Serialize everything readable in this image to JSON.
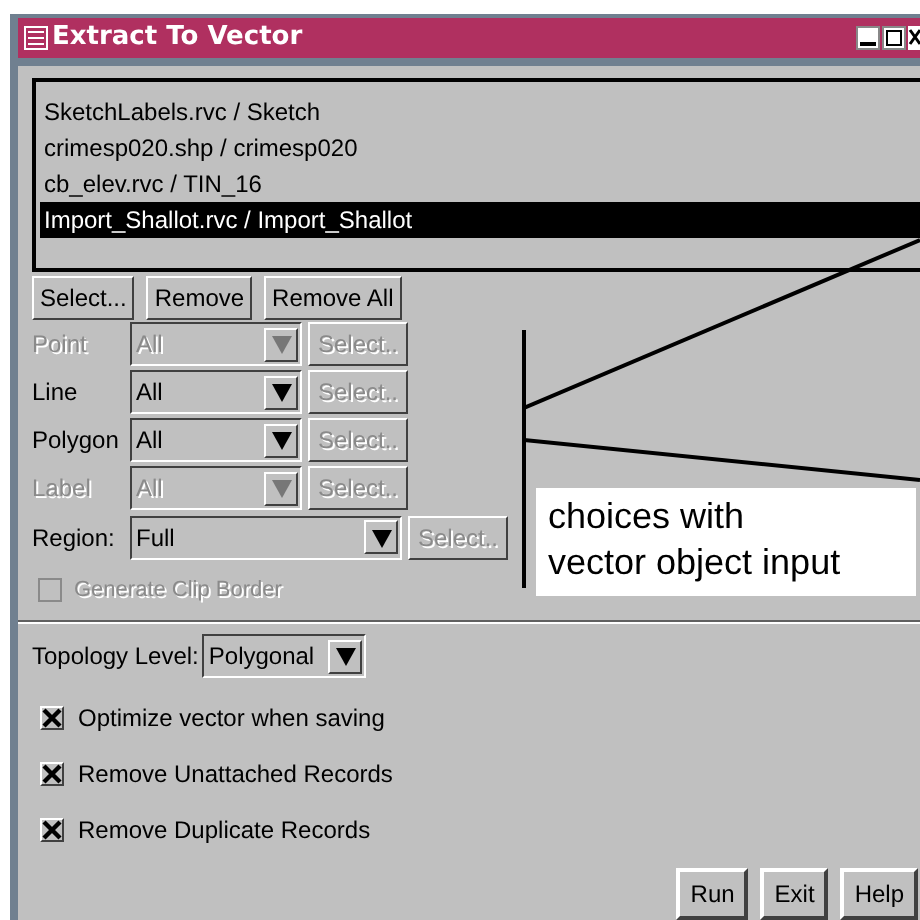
{
  "window": {
    "title": "Extract To Vector"
  },
  "files": [
    {
      "text": "SketchLabels.rvc / Sketch",
      "selected": false
    },
    {
      "text": "crimesp020.shp / crimesp020",
      "selected": false
    },
    {
      "text": "cb_elev.rvc / TIN_16",
      "selected": false
    },
    {
      "text": "Import_Shallot.rvc / Import_Shallot",
      "selected": true
    }
  ],
  "list_buttons": [
    "Select...",
    "Remove",
    "Remove All"
  ],
  "object_rows": [
    {
      "label": "Point",
      "disabled": true,
      "value": "All",
      "button": {
        "label": "Select..",
        "disabled": true
      }
    },
    {
      "label": "Line",
      "disabled": false,
      "value": "All",
      "button": {
        "label": "Select..",
        "disabled": true
      }
    },
    {
      "label": "Polygon",
      "disabled": false,
      "value": "All",
      "button": {
        "label": "Select..",
        "disabled": true
      }
    },
    {
      "label": "Label",
      "disabled": true,
      "value": "All",
      "button": {
        "label": "Select..",
        "disabled": true
      }
    }
  ],
  "region": {
    "label": "Region:",
    "value": "Full",
    "button": {
      "label": "Select..",
      "disabled": true
    }
  },
  "clip_border": {
    "label": "Generate Clip Border",
    "checked": false,
    "disabled": true
  },
  "topology": {
    "label": "Topology Level:",
    "value": "Polygonal"
  },
  "options": [
    {
      "label": "Optimize vector when saving",
      "checked": true
    },
    {
      "label": "Remove Unattached Records",
      "checked": true
    },
    {
      "label": "Remove Duplicate Records",
      "checked": true
    }
  ],
  "buttons": [
    "Run",
    "Exit",
    "Help"
  ],
  "callout": {
    "lines": [
      "choices with",
      "vector object input"
    ]
  }
}
